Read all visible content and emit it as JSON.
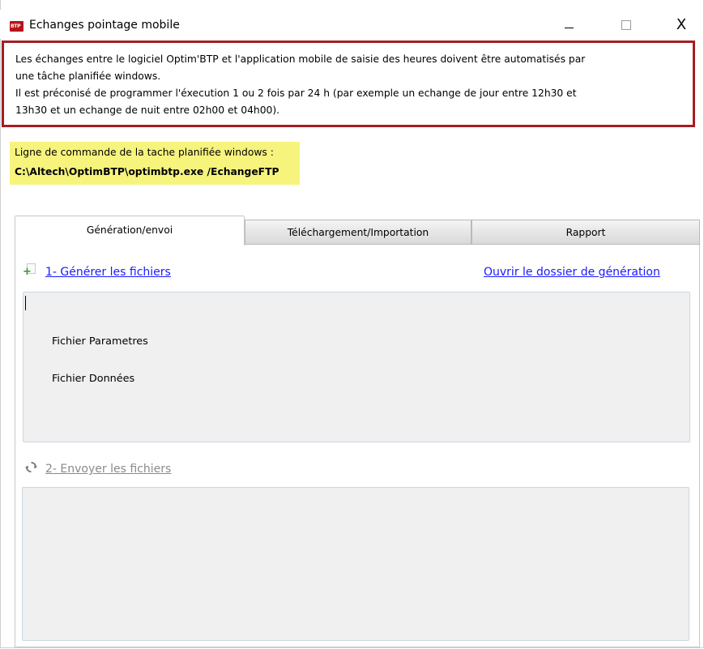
{
  "window": {
    "title": "Echanges pointage mobile",
    "icon_text": "BTP",
    "minimize_label": "—",
    "maximize_label": "☐",
    "close_label": "X"
  },
  "notice": {
    "line1": "Les échanges entre le logiciel Optim'BTP et l'application mobile de saisie des heures doivent être automatisés par",
    "line2": "une tâche planifiée windows.",
    "line3": "Il est préconisé de programmer l'éxecution 1 ou 2 fois par 24 h (par exemple un echange de jour entre 12h30 et",
    "line4": "13h30 et un echange de nuit entre 02h00 et 04h00).",
    "border_color": "#a41e22"
  },
  "command": {
    "label": "Ligne de commande de la tache planifiée windows :",
    "path": "C:\\Altech\\OptimBTP\\optimbtp.exe /EchangeFTP",
    "highlight_color": "#f7f47e"
  },
  "tabs": [
    {
      "label": "Génération/envoi",
      "active": true
    },
    {
      "label": "Téléchargement/Importation",
      "active": false
    },
    {
      "label": "Rapport",
      "active": false
    }
  ],
  "generation": {
    "generate_link": "1- Générer les fichiers",
    "open_folder_link": "Ouvrir le dossier de génération",
    "files": [
      "Fichier Parametres",
      "Fichier Données"
    ],
    "send_link": "2- Envoyer les fichiers",
    "link_color": "#1a1aff"
  },
  "icons": {
    "app": "btp-logo-icon",
    "generate": "new-document-icon",
    "send": "refresh-icon"
  }
}
